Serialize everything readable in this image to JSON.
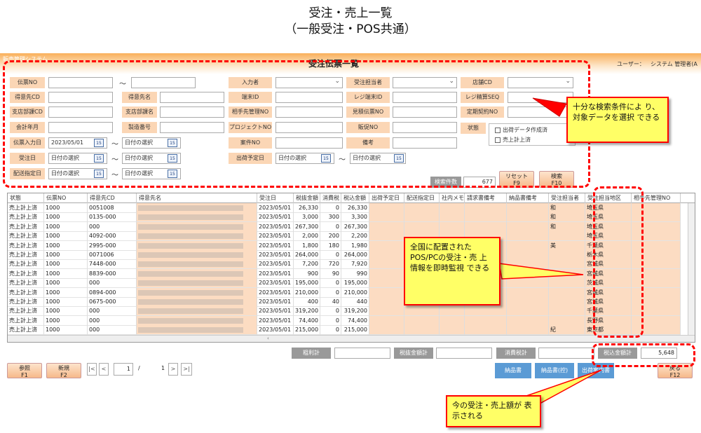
{
  "slide": {
    "title_line1": "受注・売上一覧",
    "title_line2": "（一般受注・POS共通）"
  },
  "app": {
    "name": "販売管理システム",
    "screen_title": "受注伝票一覧",
    "user_label": "ユーザー：",
    "user_name": "システム 管理者(A"
  },
  "search": {
    "labels": {
      "slip_no": "伝票NO",
      "customer_cd": "得意先CD",
      "customer_name": "得意先名",
      "branch_cd": "支店部課CD",
      "branch_name": "支店部課名",
      "fiscal_month": "会計年月",
      "serial_no": "製造番号",
      "slip_date": "伝票入力日",
      "order_date": "受注日",
      "delivery_date": "配送指定日",
      "entered_by": "入力者",
      "terminal_id": "端末ID",
      "partner_mgmt_no": "相手先管理NO",
      "project_no": "プロジェクトNO",
      "case_no": "案件NO",
      "ship_date": "出荷予定日",
      "order_staff": "受注担当者",
      "register_terminal": "レジ端末ID",
      "estimate_no": "見積伝票NO",
      "promo_no": "販促NO",
      "remarks": "備考",
      "store_cd": "店舗CD",
      "register_seq": "レジ精算SEQ",
      "contract_no": "定期契約NO",
      "status": "状態"
    },
    "slip_date_from": "2023/05/01",
    "date_placeholder": "日付の選択",
    "calendar_icon_text": "15",
    "tilde": "～",
    "status_options": [
      "出荷データ作成済",
      "売上計上済"
    ],
    "result_count_label": "検索件数",
    "result_count": "677",
    "reset_button": {
      "label": "リセット",
      "key": "F9"
    },
    "search_button": {
      "label": "検索",
      "key": "F10"
    }
  },
  "grid": {
    "columns": [
      "状態",
      "伝票NO",
      "得意先CD",
      "得意先名",
      "受注日",
      "税抜金額",
      "消費税",
      "税込金額",
      "出荷予定日",
      "配送指定日",
      "社内メモ",
      "請求書備考",
      "納品書備考",
      "受注担当者",
      "受注担当地区",
      "相手先管理NO"
    ],
    "rows": [
      {
        "status": "売上計上済",
        "slip_no": "1000",
        "customer_cd": "0051008",
        "date": "2023/05/01",
        "net": "26,330",
        "tax": "0",
        "gross": "26,330",
        "staff": "和",
        "area": "埼玉県"
      },
      {
        "status": "売上計上済",
        "slip_no": "1000",
        "customer_cd": "0135-000",
        "date": "2023/05/01",
        "net": "3,000",
        "tax": "300",
        "gross": "3,300",
        "staff": "和",
        "area": "埼玉県"
      },
      {
        "status": "売上計上済",
        "slip_no": "1000",
        "customer_cd": "000",
        "date": "2023/05/01",
        "net": "267,300",
        "tax": "0",
        "gross": "267,300",
        "staff": "和",
        "area": "埼玉県"
      },
      {
        "status": "売上計上済",
        "slip_no": "1000",
        "customer_cd": "4092-000",
        "date": "2023/05/01",
        "net": "2,000",
        "tax": "200",
        "gross": "2,200",
        "staff": "",
        "area": "埼玉県"
      },
      {
        "status": "売上計上済",
        "slip_no": "1000",
        "customer_cd": "2995-000",
        "date": "2023/05/01",
        "net": "1,800",
        "tax": "180",
        "gross": "1,980",
        "staff": "美",
        "area": "千葉県"
      },
      {
        "status": "売上計上済",
        "slip_no": "1000",
        "customer_cd": "0071006",
        "date": "2023/05/01",
        "net": "264,000",
        "tax": "0",
        "gross": "264,000",
        "staff": "",
        "area": "栃木県"
      },
      {
        "status": "売上計上済",
        "slip_no": "1000",
        "customer_cd": "7448-000",
        "date": "2023/05/01",
        "net": "7,200",
        "tax": "720",
        "gross": "7,920",
        "staff": "",
        "area": "宮城県"
      },
      {
        "status": "売上計上済",
        "slip_no": "1000",
        "customer_cd": "8839-000",
        "date": "2023/05/01",
        "net": "900",
        "tax": "90",
        "gross": "990",
        "staff": "",
        "area": "宮城県"
      },
      {
        "status": "売上計上済",
        "slip_no": "1000",
        "customer_cd": "000",
        "date": "2023/05/01",
        "net": "195,000",
        "tax": "0",
        "gross": "195,000",
        "staff": "",
        "area": "茨城県"
      },
      {
        "status": "売上計上済",
        "slip_no": "1000",
        "customer_cd": "0894-000",
        "date": "2023/05/01",
        "net": "210,000",
        "tax": "0",
        "gross": "210,000",
        "staff": "",
        "area": "宮城県"
      },
      {
        "status": "売上計上済",
        "slip_no": "1000",
        "customer_cd": "0675-000",
        "date": "2023/05/01",
        "net": "400",
        "tax": "40",
        "gross": "440",
        "staff": "",
        "area": "宮城県"
      },
      {
        "status": "売上計上済",
        "slip_no": "1000",
        "customer_cd": "000",
        "date": "2023/05/01",
        "net": "319,200",
        "tax": "0",
        "gross": "319,200",
        "staff": "",
        "area": "千葉県"
      },
      {
        "status": "売上計上済",
        "slip_no": "1000",
        "customer_cd": "000",
        "date": "2023/05/01",
        "net": "74,400",
        "tax": "0",
        "gross": "74,400",
        "staff": "",
        "area": "長野県"
      },
      {
        "status": "売上計上済",
        "slip_no": "1000",
        "customer_cd": "000",
        "date": "2023/05/01",
        "net": "215,000",
        "tax": "0",
        "gross": "215,000",
        "staff": "紀",
        "area": "東京都"
      }
    ]
  },
  "totals": {
    "gross_profit": "粗利計",
    "net_total": "税抜金額計",
    "tax_total": "消費税計",
    "gross_total": "税込金額計",
    "gross_total_value": "5,648"
  },
  "footer": {
    "ref_button": {
      "label": "参照",
      "key": "F1"
    },
    "new_button": {
      "label": "新規",
      "key": "F2"
    },
    "page_current": "1",
    "page_sep": "/",
    "page_total": "1",
    "first": "|<",
    "prev": "<",
    "next": ">",
    "last": ">|",
    "delivery_note": "納品書",
    "delivery_note_copy": "納品書(控)",
    "shipping_info": "出荷案内書",
    "back_button": {
      "label": "戻る",
      "key": "F12"
    }
  },
  "callouts": {
    "search": "十分な検索条件によ り、対象データを選択 できる",
    "monitor": "全国に配置された POS/PCの受注・売 上情報を即時監視 できる",
    "amount": "今の受注・売上額が 表示される"
  },
  "colors": {
    "accent_orange": "#f9b05a",
    "label_peach": "#fbd6b5",
    "highlight_red": "#ff0000",
    "callout_yellow": "#ffff66",
    "action_blue": "#5b9bd5"
  }
}
